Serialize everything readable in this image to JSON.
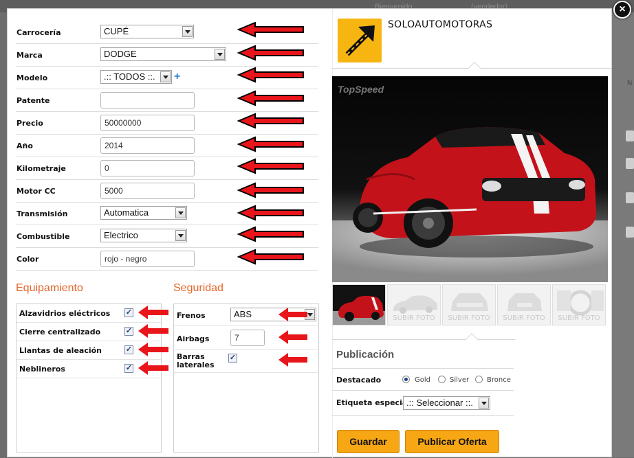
{
  "backdrop": {
    "text_left": "Bienvenido",
    "text_right": "(vendedor)",
    "side_text": "N"
  },
  "modal": {
    "close_label": "×"
  },
  "form": {
    "fields": [
      {
        "label": "Carrocería",
        "type": "select",
        "value": "CUPÉ"
      },
      {
        "label": "Marca",
        "type": "select",
        "value": "DODGE"
      },
      {
        "label": "Modelo",
        "type": "select",
        "value": ".:: TODOS ::.",
        "extra": "+"
      },
      {
        "label": "Patente",
        "type": "text",
        "value": ""
      },
      {
        "label": "Precio",
        "type": "text",
        "value": "50000000"
      },
      {
        "label": "Año",
        "type": "text",
        "value": "2014"
      },
      {
        "label": "Kilometraje",
        "type": "text",
        "value": "0"
      },
      {
        "label": "Motor CC",
        "type": "text",
        "value": "5000"
      },
      {
        "label": "Transmisión",
        "type": "select",
        "value": "Automatica"
      },
      {
        "label": "Combustible",
        "type": "select",
        "value": "Electrico"
      },
      {
        "label": "Color",
        "type": "text",
        "value": "rojo - negro"
      }
    ]
  },
  "equipamiento": {
    "title": "Equipamiento",
    "items": [
      {
        "label": "Alzavidrios eléctricos",
        "checked": true
      },
      {
        "label": "Cierre centralizado",
        "checked": true
      },
      {
        "label": "Llantas de aleación",
        "checked": true
      },
      {
        "label": "Neblineros",
        "checked": true
      }
    ]
  },
  "seguridad": {
    "title": "Seguridad",
    "frenos": {
      "label": "Frenos",
      "value": "ABS"
    },
    "airbags": {
      "label": "Airbags",
      "value": "7"
    },
    "barras": {
      "label_line1": "Barras",
      "label_line2": "laterales",
      "checked": true
    }
  },
  "dealer": {
    "name": "SOLOAUTOMOTORAS"
  },
  "photo": {
    "watermark": "TopSpeed"
  },
  "thumbnails": [
    {
      "caption": ""
    },
    {
      "caption": "SUBIR FOTO"
    },
    {
      "caption": "SUBIR FOTO"
    },
    {
      "caption": "SUBIR FOTO"
    },
    {
      "caption": "SUBIR FOTO"
    }
  ],
  "publicacion": {
    "title": "Publicación",
    "destacado_label": "Destacado",
    "options": [
      {
        "label": "Gold",
        "selected": true
      },
      {
        "label": "Silver",
        "selected": false
      },
      {
        "label": "Bronce",
        "selected": false
      }
    ],
    "etiqueta_label": "Etiqueta especial",
    "etiqueta_value": ".:: Seleccionar ::."
  },
  "buttons": {
    "guardar": "Guardar",
    "publicar": "Publicar Oferta"
  },
  "colors": {
    "accent": "#f7a614",
    "section": "#e2662a",
    "annotation_arrow": "#e8151b"
  }
}
